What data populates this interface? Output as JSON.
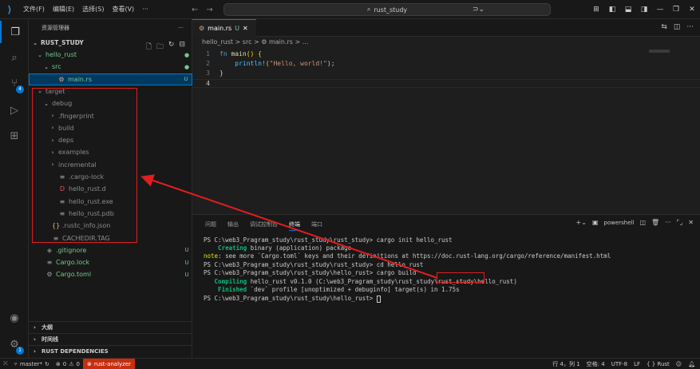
{
  "titlebar": {
    "menus": [
      "文件(F)",
      "编辑(E)",
      "选择(S)",
      "查看(V)",
      "···"
    ],
    "search_text": "rust_study",
    "nav_back": "←",
    "nav_forward": "→"
  },
  "sidebar": {
    "title": "资源管理器",
    "more": "···",
    "root": "RUST_STUDY",
    "items": [
      {
        "label": "hello_rust",
        "stat": "●",
        "color": "#73c991"
      },
      {
        "label": "src",
        "stat": "●",
        "color": "#73c991"
      },
      {
        "label": "main.rs",
        "stat": "U",
        "color": "#73c991"
      },
      {
        "label": "target",
        "stat": "",
        "color": "#8c8c8c"
      },
      {
        "label": "debug",
        "stat": "",
        "color": "#8c8c8c"
      },
      {
        "label": ".fingerprint",
        "stat": "",
        "color": "#8c8c8c"
      },
      {
        "label": "build",
        "stat": "",
        "color": "#8c8c8c"
      },
      {
        "label": "deps",
        "stat": "",
        "color": "#8c8c8c"
      },
      {
        "label": "examples",
        "stat": "",
        "color": "#8c8c8c"
      },
      {
        "label": "incremental",
        "stat": "",
        "color": "#8c8c8c"
      },
      {
        "label": ".cargo-lock",
        "stat": "",
        "color": "#8c8c8c"
      },
      {
        "label": "hello_rust.d",
        "stat": "",
        "color": "#8c8c8c"
      },
      {
        "label": "hello_rust.exe",
        "stat": "",
        "color": "#8c8c8c"
      },
      {
        "label": "hello_rust.pdb",
        "stat": "",
        "color": "#8c8c8c"
      },
      {
        "label": ".rustc_info.json",
        "stat": "",
        "color": "#8c8c8c"
      },
      {
        "label": "CACHEDIR.TAG",
        "stat": "",
        "color": "#8c8c8c"
      },
      {
        "label": ".gitignore",
        "stat": "U",
        "color": "#73c991"
      },
      {
        "label": "Cargo.lock",
        "stat": "U",
        "color": "#73c991"
      },
      {
        "label": "Cargo.toml",
        "stat": "U",
        "color": "#73c991"
      }
    ],
    "sections": [
      "大纲",
      "时间线",
      "RUST DEPENDENCIES"
    ]
  },
  "editor": {
    "tab_label": "main.rs",
    "tab_status": "U",
    "breadcrumb": "hello_rust > src > ⚙ main.rs > ...",
    "line_numbers": [
      "1",
      "2",
      "3",
      "4"
    ],
    "code": {
      "l1_kw": "fn",
      "l1_fn": "main",
      "l1_rest": "() {",
      "l2_macro": "println!",
      "l2_open": "(",
      "l2_str": "\"Hello, world!\"",
      "l2_close": ");",
      "l3": "}"
    }
  },
  "panel": {
    "tabs": [
      "问题",
      "输出",
      "调试控制台",
      "终端",
      "端口"
    ],
    "active_tab": "终端",
    "shell": "powershell",
    "terminal": {
      "l1": "PS C:\\web3_Pragram_study\\rust_study\\rust_study> cargo init hello_rust",
      "l2_green": "    Creating",
      "l2_rest": " binary (application) package",
      "l3_note": "note",
      "l3_rest": ": see more `Cargo.toml` keys and their definitions at https://doc.rust-lang.org/cargo/reference/manifest.html",
      "l4": "PS C:\\web3_Pragram_study\\rust_study\\rust_study> cd hello_rust",
      "l5_prompt": "PS C:\\web3_Pragram_study\\rust_study\\hello_rust> ",
      "l5_cmd": "cargo build",
      "l6_green": "   Compiling",
      "l6_rest": " hello_rust v0.1.0 (C:\\web3_Pragram_study\\rust_study\\rust_study\\hello_rust)",
      "l7_green": "    Finished",
      "l7_rest": " `dev` profile [unoptimized + debuginfo] target(s) in 1.75s",
      "l8": "PS C:\\web3_Pragram_study\\rust_study\\hello_rust> "
    }
  },
  "statusbar": {
    "branch": "master*",
    "errors": "0",
    "warnings": "0",
    "rust_analyzer": "rust-analyzer",
    "position": "行 4，列 1",
    "spaces": "空格: 4",
    "encoding": "UTF-8",
    "eol": "LF",
    "language": "{ } Rust"
  }
}
